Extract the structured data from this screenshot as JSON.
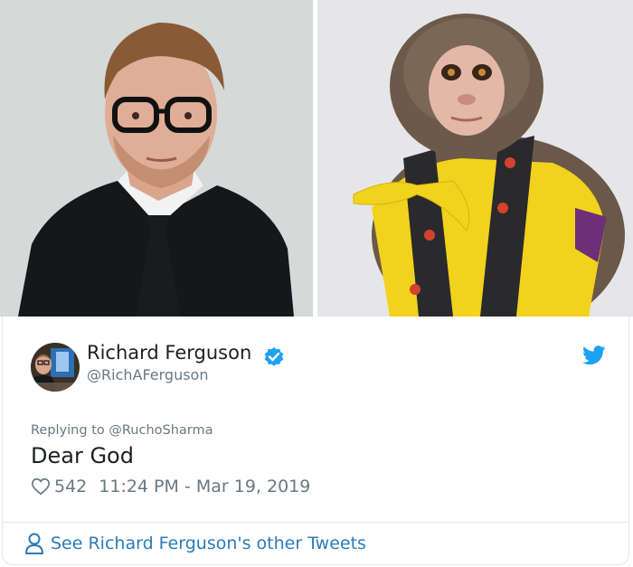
{
  "images": {
    "left": {
      "description_icon": "man-portrait-photo"
    },
    "right": {
      "description_icon": "monkey-portrait-photo"
    }
  },
  "tweet": {
    "author_name": "Richard Ferguson",
    "author_handle": "@RichAFerguson",
    "verified_icon": "verified-badge-icon",
    "brand_icon": "twitter-bird-icon",
    "replying_prefix": "Replying to",
    "replying_handle": "@RuchoSharma",
    "text": "Dear God",
    "likes": "542",
    "timestamp": "11:24 PM - Mar 19, 2019"
  },
  "footer": {
    "icon": "user-outline-icon",
    "link_label": "See Richard Ferguson's other Tweets"
  },
  "colors": {
    "twitter_blue": "#1da1f2",
    "link_blue": "#2b7bb9",
    "muted_text": "#697882",
    "primary_text": "#1c2022"
  }
}
